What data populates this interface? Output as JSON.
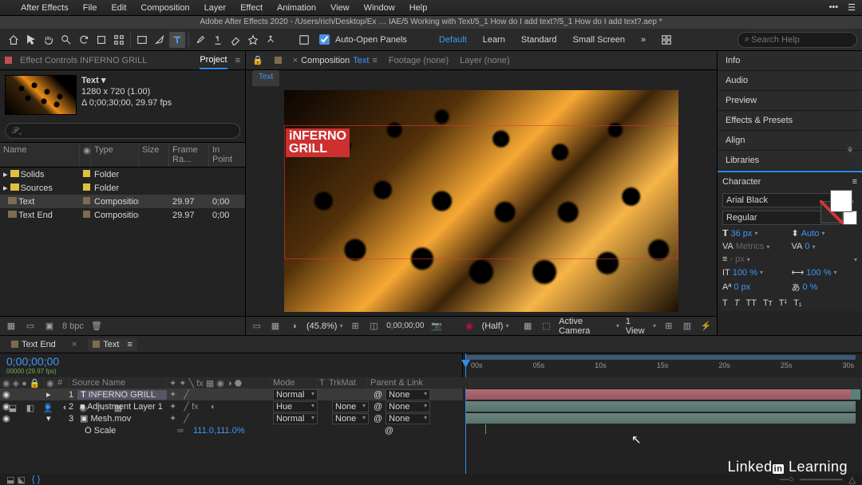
{
  "menubar": {
    "app": "After Effects",
    "items": [
      "File",
      "Edit",
      "Composition",
      "Layer",
      "Effect",
      "Animation",
      "View",
      "Window",
      "Help"
    ]
  },
  "titlebar": "Adobe After Effects 2020 - /Users/rich/Desktop/Ex … IAE/5 Working with Text/5_1 How do I add text?/5_1 How do I add text?.aep *",
  "toolbar": {
    "autoopen": "Auto-Open Panels",
    "workspaces": [
      "Default",
      "Learn",
      "Standard",
      "Small Screen"
    ],
    "selected_ws": 0,
    "search_ph": "Search Help"
  },
  "project": {
    "effect_controls": "Effect Controls INFERNO GRILL",
    "project_tab": "Project",
    "selected_name": "Text ▾",
    "dims": "1280 x 720 (1.00)",
    "dur": "Δ 0;00;30;00, 29.97 fps",
    "cols": [
      "Name",
      "Type",
      "Size",
      "Frame Ra...",
      "In Point"
    ],
    "rows": [
      {
        "name": "Solids",
        "type": "Folder",
        "size": "",
        "fr": "",
        "in": "",
        "k": "fold",
        "tw": true
      },
      {
        "name": "Sources",
        "type": "Folder",
        "size": "",
        "fr": "",
        "in": "",
        "k": "fold",
        "tw": true
      },
      {
        "name": "Text",
        "type": "Composition",
        "size": "",
        "fr": "29.97",
        "in": "0;00",
        "k": "comp",
        "sel": true
      },
      {
        "name": "Text End",
        "type": "Composition",
        "size": "",
        "fr": "29.97",
        "in": "0;00",
        "k": "comp"
      }
    ],
    "bpc": "8 bpc"
  },
  "viewer": {
    "comp_prefix": "Composition",
    "comp_name": "Text",
    "footage": "Footage (none)",
    "layer": "Layer (none)",
    "subtab": "Text",
    "text": "iNFERNO\nGRILL",
    "footer": {
      "zoom": "(45.8%)",
      "time": "0;00;00;00",
      "res": "(Half)",
      "cam": "Active Camera",
      "views": "1 View"
    }
  },
  "rightcol": {
    "panels": [
      "Info",
      "Audio",
      "Preview",
      "Effects & Presets",
      "Align",
      "Libraries"
    ],
    "character": {
      "title": "Character",
      "font": "Arial Black",
      "style": "Regular",
      "size": "36 px",
      "leading": "Auto",
      "kerning": "Metrics",
      "tracking": "0",
      "stroke": "- px",
      "vscale": "100 %",
      "hscale": "100 %",
      "baseline": "0 px",
      "tsume": "0 %"
    }
  },
  "timeline": {
    "tabs": [
      {
        "name": "Text End"
      },
      {
        "name": "Text",
        "sel": true
      }
    ],
    "timecode": "0;00;00;00",
    "ruler": [
      "00s",
      "05s",
      "10s",
      "15s",
      "20s",
      "25s",
      "30s"
    ],
    "cols": [
      "Source Name",
      "Mode",
      "T",
      "TrkMat",
      "Parent & Link"
    ],
    "layers": [
      {
        "num": "1",
        "name": "INFERNO GRILL",
        "color": "#c05058",
        "mode": "Normal",
        "trk": "",
        "parent": "None",
        "sel": true,
        "ico": "T"
      },
      {
        "num": "2",
        "name": "Adjustment Layer 1",
        "color": "#5a8079",
        "mode": "Hue",
        "trk": "None",
        "parent": "None",
        "ico": "■"
      },
      {
        "num": "3",
        "name": "Mesh.mov",
        "color": "#5a8079",
        "mode": "Normal",
        "trk": "None",
        "parent": "None",
        "ico": "▣"
      }
    ],
    "prop": {
      "name": "Scale",
      "val": "111.0,111.0%"
    }
  },
  "brand": "Linked in Learning"
}
